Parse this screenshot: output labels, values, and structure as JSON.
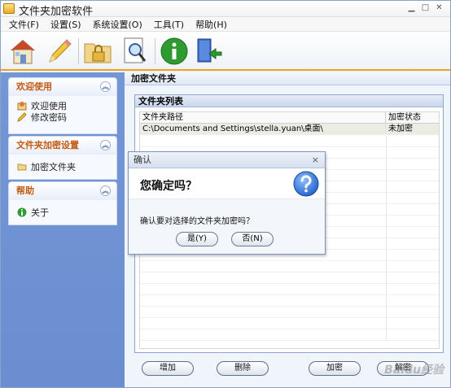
{
  "window": {
    "title": "文件夹加密软件",
    "controls": [
      "minimize-icon",
      "maximize-icon",
      "close-icon"
    ]
  },
  "menubar": {
    "items": [
      {
        "label": "文件(F)"
      },
      {
        "label": "设置(S)"
      },
      {
        "label": "系统设置(O)"
      },
      {
        "label": "工具(T)"
      },
      {
        "label": "帮助(H)"
      }
    ]
  },
  "toolbar": {
    "icons": [
      "home-icon",
      "pencil-icon",
      "folder-lock-icon",
      "search-document-icon",
      "info-icon",
      "exit-icon"
    ]
  },
  "sidebar": {
    "panels": [
      {
        "title": "欢迎使用",
        "items": [
          {
            "label": "欢迎使用",
            "icon": "welcome-icon"
          },
          {
            "label": "修改密码",
            "icon": "pencil-icon"
          }
        ]
      },
      {
        "title": "文件夹加密设置",
        "items": [
          {
            "label": "加密文件夹",
            "icon": "folder-icon"
          }
        ]
      },
      {
        "title": "帮助",
        "items": [
          {
            "label": "关于",
            "icon": "info-icon"
          }
        ]
      }
    ]
  },
  "main": {
    "heading": "加密文件夹",
    "group_title": "文件夹列表",
    "columns": {
      "path": "文件夹路径",
      "status": "加密状态"
    },
    "rows": [
      {
        "path": "C:\\Documents and Settings\\stella.yuan\\桌面\\",
        "status": "未加密"
      }
    ],
    "buttons": {
      "add": "增加",
      "delete": "删除",
      "encrypt": "加密",
      "decrypt": "解密"
    }
  },
  "dialog": {
    "title": "确认",
    "close": "×",
    "heading": "您确定吗？",
    "message": "确认要对选择的文件夹加密吗？",
    "yes": "是(Y)",
    "no": "否(N)"
  },
  "watermark": "Baidu经验",
  "colors": {
    "accent": "#c25a12",
    "sidebar_bg": "#6f93d4",
    "toolbar_rule": "#f0a020"
  }
}
